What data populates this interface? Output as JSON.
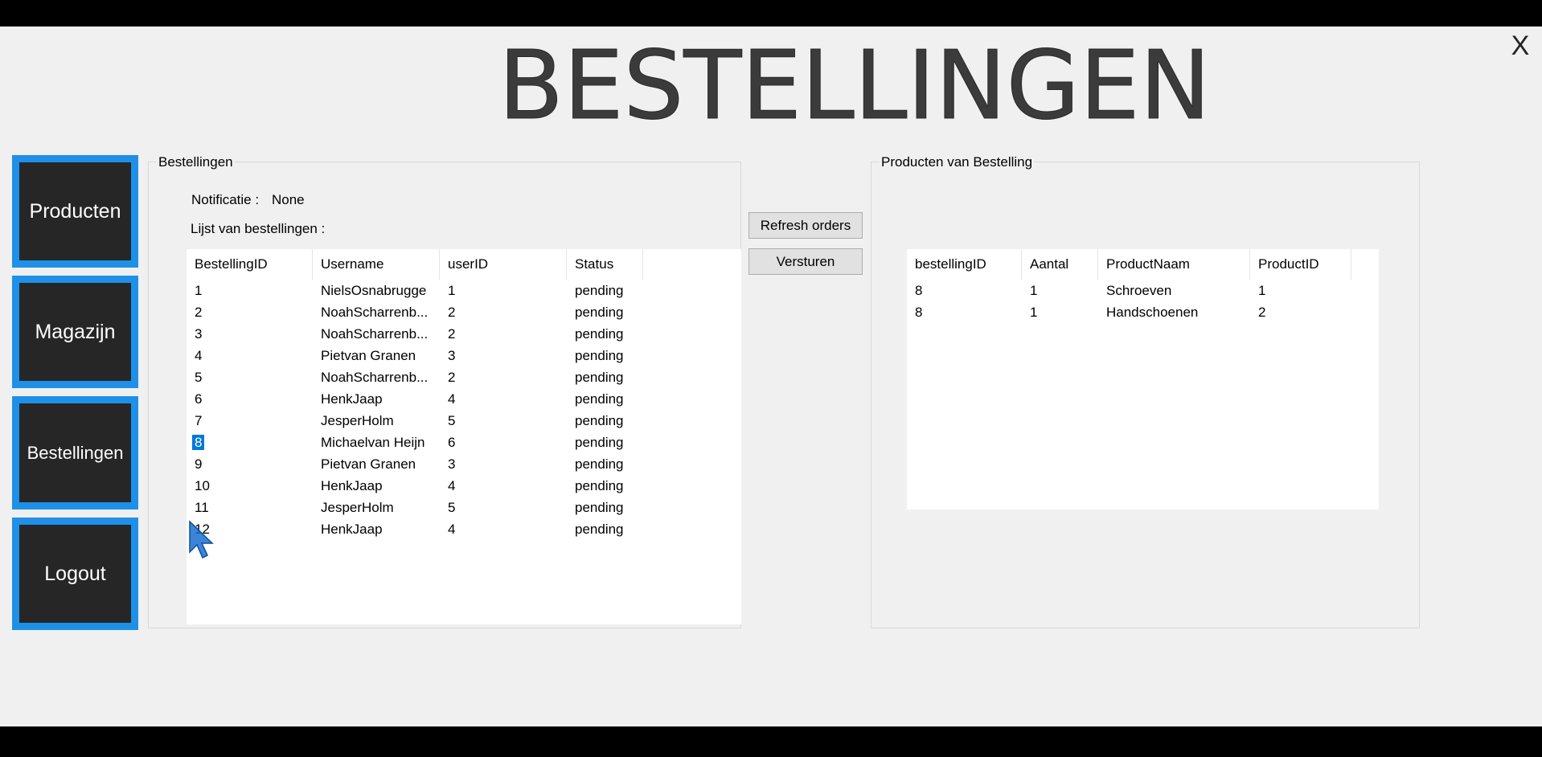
{
  "header": {
    "title": "BESTELLINGEN",
    "close_label": "X"
  },
  "nav": {
    "items": [
      {
        "label": "Producten"
      },
      {
        "label": "Magazijn"
      },
      {
        "label": "Bestellingen"
      },
      {
        "label": "Logout"
      }
    ]
  },
  "orders_panel": {
    "legend": "Bestellingen",
    "notification_label": "Notificatie :",
    "notification_value": "None",
    "list_label": "Lijst van bestellingen :",
    "columns": [
      "BestellingID",
      "Username",
      "userID",
      "Status"
    ],
    "rows": [
      [
        "1",
        "NielsOsnabrugge",
        "1",
        "pending"
      ],
      [
        "2",
        "NoahScharrenb...",
        "2",
        "pending"
      ],
      [
        "3",
        "NoahScharrenb...",
        "2",
        "pending"
      ],
      [
        "4",
        "Pietvan Granen",
        "3",
        "pending"
      ],
      [
        "5",
        "NoahScharrenb...",
        "2",
        "pending"
      ],
      [
        "6",
        "HenkJaap",
        "4",
        "pending"
      ],
      [
        "7",
        "JesperHolm",
        "5",
        "pending"
      ],
      [
        "8",
        "Michaelvan Heijn",
        "6",
        "pending"
      ],
      [
        "9",
        "Pietvan Granen",
        "3",
        "pending"
      ],
      [
        "10",
        "HenkJaap",
        "4",
        "pending"
      ],
      [
        "11",
        "JesperHolm",
        "5",
        "pending"
      ],
      [
        "12",
        "HenkJaap",
        "4",
        "pending"
      ]
    ],
    "selected_index": 7
  },
  "actions": {
    "refresh_label": "Refresh orders",
    "send_label": "Versturen"
  },
  "products_panel": {
    "legend": "Producten van Bestelling",
    "columns": [
      "bestellingID",
      "Aantal",
      "ProductNaam",
      "ProductID"
    ],
    "rows": [
      [
        "8",
        "1",
        "Schroeven",
        "1"
      ],
      [
        "8",
        "1",
        "Handschoenen",
        "2"
      ]
    ]
  },
  "colors": {
    "accent": "#1e90e8",
    "nav_bg": "#262626",
    "selection": "#0078d7",
    "window_bg": "#f0f0f0"
  },
  "icons": {
    "close": "close-icon",
    "cursor": "mouse-pointer-icon"
  }
}
